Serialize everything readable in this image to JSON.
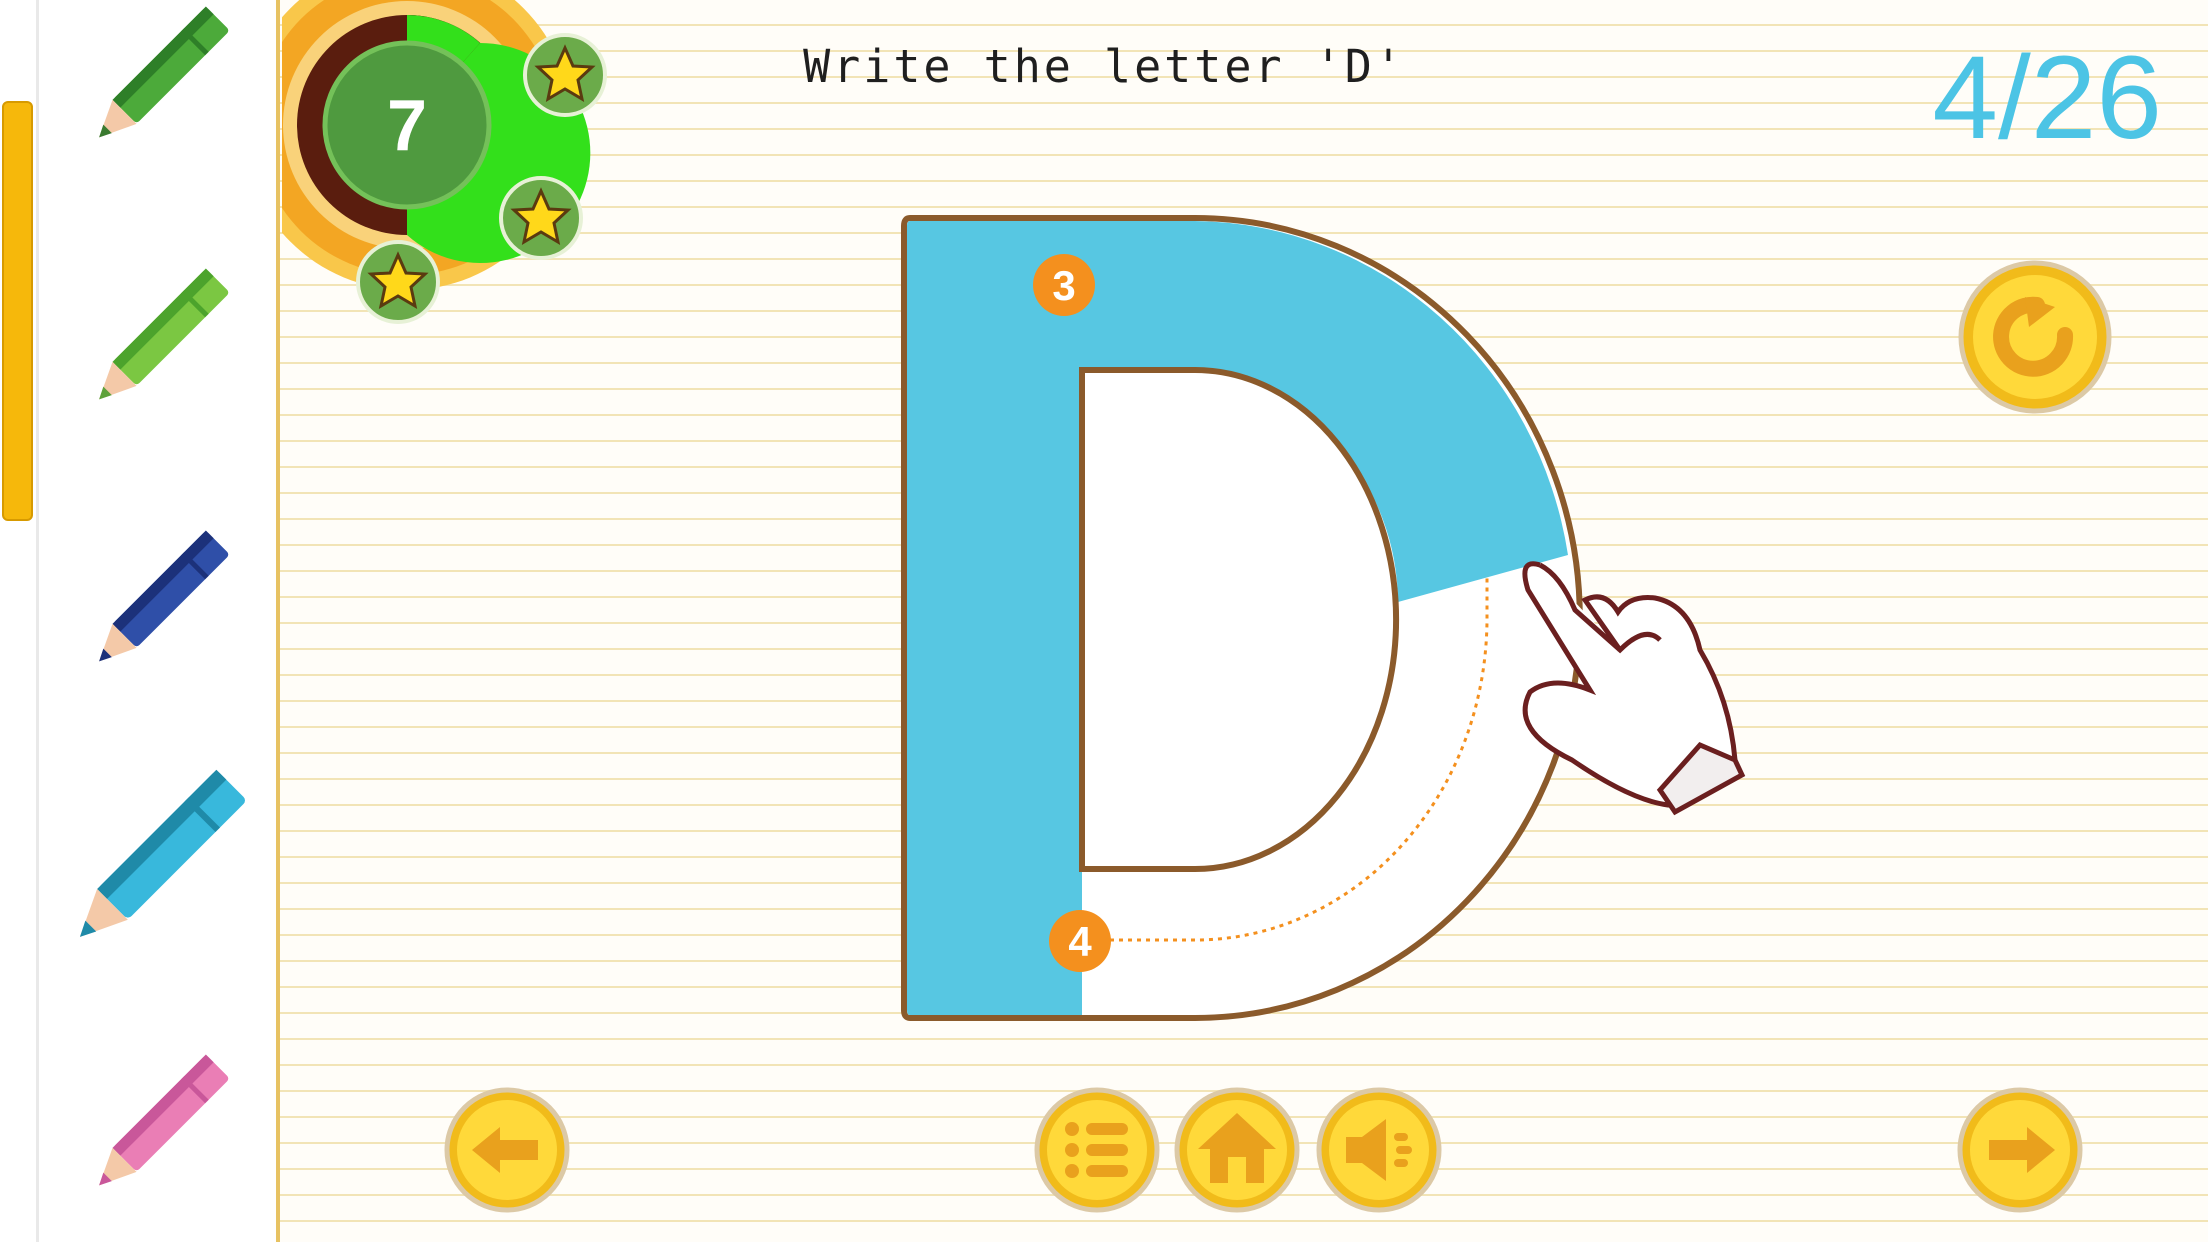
{
  "instruction": "Write the letter 'D'",
  "progress": "4/26",
  "timer": {
    "value": "7"
  },
  "stars": {
    "count": 3
  },
  "letter": "D",
  "stroke_markers": [
    "3",
    "4"
  ],
  "pencils": [
    {
      "name": "dark-green",
      "color": "#4caa3a"
    },
    {
      "name": "light-green",
      "color": "#7bc742"
    },
    {
      "name": "blue",
      "color": "#2f4fa8"
    },
    {
      "name": "cyan",
      "color": "#38b8dc"
    },
    {
      "name": "pink",
      "color": "#ea7eb5"
    }
  ],
  "colors": {
    "fill": "#57c7e2",
    "outline": "#8b5a2b",
    "accent": "#f4901e",
    "progress_text": "#4cc4e5"
  },
  "buttons": {
    "back": "back-arrow-icon",
    "menu": "list-icon",
    "home": "home-icon",
    "sound": "speaker-icon",
    "next": "next-arrow-icon",
    "replay": "replay-icon"
  }
}
